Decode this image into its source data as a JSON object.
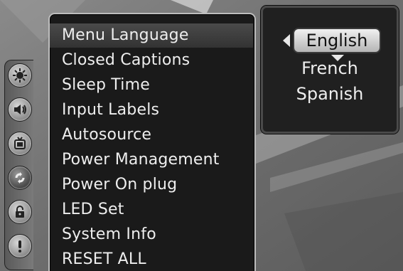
{
  "menu": {
    "items": [
      {
        "label": "Menu Language"
      },
      {
        "label": "Closed Captions"
      },
      {
        "label": "Sleep Time"
      },
      {
        "label": "Input Labels"
      },
      {
        "label": "Autosource"
      },
      {
        "label": "Power Management"
      },
      {
        "label": "Power On plug"
      },
      {
        "label": "LED Set"
      },
      {
        "label": "System Info"
      },
      {
        "label": "RESET ALL"
      }
    ],
    "selected_index": 0
  },
  "language_submenu": {
    "selected": "English",
    "options": [
      "French",
      "Spanish"
    ]
  },
  "tabs": [
    {
      "icon": "picture-settings-icon"
    },
    {
      "icon": "audio-speaker-icon"
    },
    {
      "icon": "tv-channel-icon"
    },
    {
      "icon": "setup-icon",
      "active": true
    },
    {
      "icon": "lock-icon"
    },
    {
      "icon": "info-exclamation-icon"
    }
  ]
}
